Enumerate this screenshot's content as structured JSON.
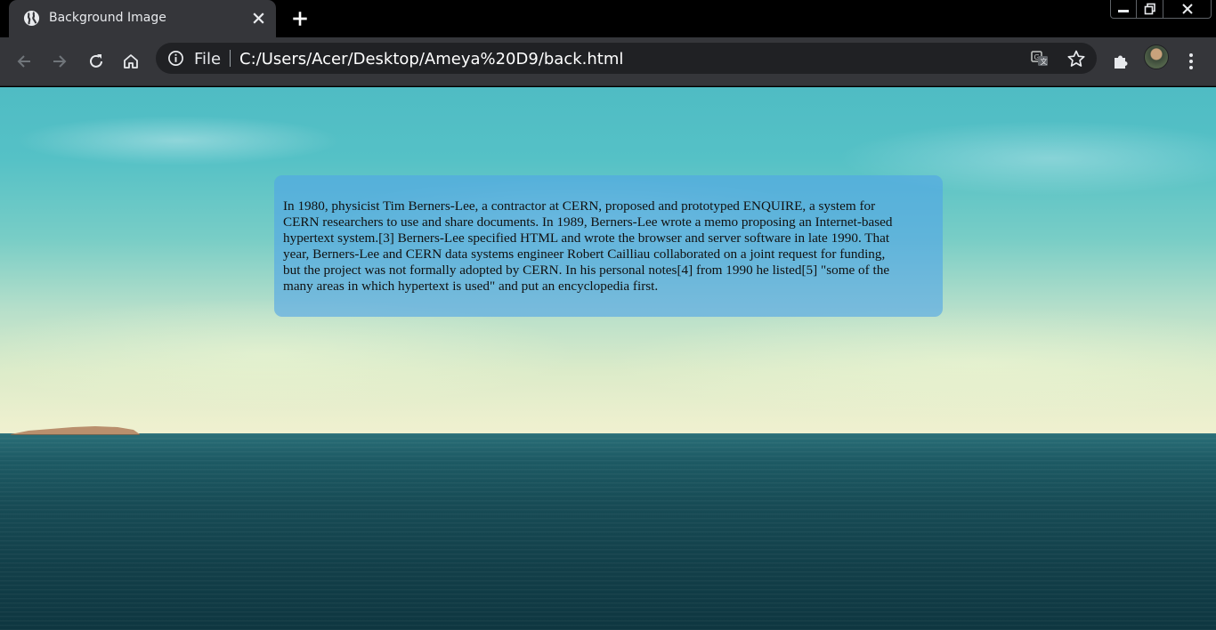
{
  "browser": {
    "tab": {
      "title": "Background Image",
      "favicon": "globe-icon",
      "close_icon": "close-icon"
    },
    "new_tab_icon": "plus-icon",
    "window_controls": [
      "minimize-icon",
      "restore-icon",
      "close-icon"
    ],
    "toolbar": {
      "back_icon": "arrow-left-icon",
      "forward_icon": "arrow-right-icon",
      "reload_icon": "reload-icon",
      "home_icon": "home-icon",
      "omnibox": {
        "info_icon": "info-icon",
        "scheme_label": "File",
        "url": "C:/Users/Acer/Desktop/Ameya%20D9/back.html",
        "translate_icon": "translate-icon",
        "bookmark_icon": "star-icon"
      },
      "extensions_icon": "puzzle-icon",
      "profile_icon": "avatar",
      "menu_icon": "kebab-menu-icon"
    }
  },
  "page": {
    "paragraph": "In 1980, physicist Tim Berners-Lee, a contractor at CERN, proposed and prototyped ENQUIRE, a system for\nCERN researchers to use and share documents. In 1989, Berners-Lee wrote a memo proposing an Internet-based\nhypertext system.[3] Berners-Lee specified HTML and wrote the browser and server software in late 1990. That\nyear, Berners-Lee and CERN data systems engineer Robert Cailliau collaborated on a joint request for funding,\nbut the project was not formally adopted by CERN. In his personal notes[4] from 1990 he listed[5] \"some of the\nmany areas in which hypertext is used\" and put an encyclopedia first."
  },
  "colors": {
    "tab_bg": "#35363a",
    "frame_bg": "#000000",
    "omnibox_bg": "#202124",
    "card_bg": "#50a5e6"
  }
}
